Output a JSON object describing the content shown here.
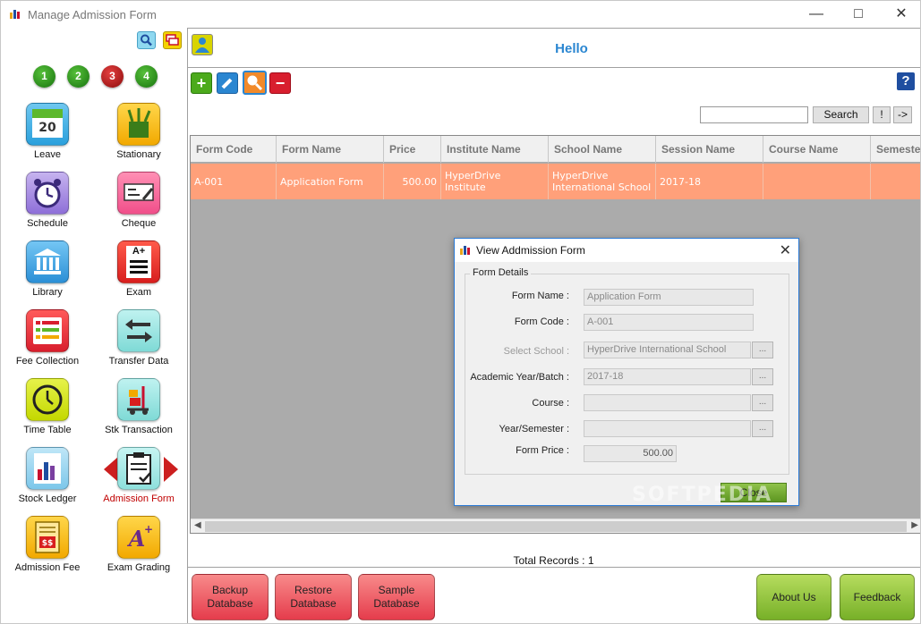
{
  "window": {
    "title": "Manage Admission Form"
  },
  "sidebar": {
    "steps": [
      "1",
      "2",
      "3",
      "4"
    ],
    "modules": [
      {
        "label": "Leave"
      },
      {
        "label": "Stationary"
      },
      {
        "label": "Schedule"
      },
      {
        "label": "Cheque"
      },
      {
        "label": "Library"
      },
      {
        "label": "Exam"
      },
      {
        "label": "Fee Collection"
      },
      {
        "label": "Transfer Data"
      },
      {
        "label": "Time Table"
      },
      {
        "label": "Stk Transaction"
      },
      {
        "label": "Stock Ledger"
      },
      {
        "label": "Admission Form"
      },
      {
        "label": "Admission Fee"
      },
      {
        "label": "Exam Grading"
      }
    ],
    "leave_day": "20",
    "exam_text": "A+"
  },
  "header": {
    "greeting": "Hello"
  },
  "toolbar": {
    "add": "+",
    "delete": "−",
    "help": "?"
  },
  "search": {
    "value": "",
    "button": "Search",
    "bang": "!",
    "arrow": "->"
  },
  "grid": {
    "columns": [
      {
        "label": "Form Code"
      },
      {
        "label": "Form Name"
      },
      {
        "label": "Price"
      },
      {
        "label": "Institute Name"
      },
      {
        "label": "School Name"
      },
      {
        "label": "Session Name"
      },
      {
        "label": "Course Name"
      },
      {
        "label": "Semester Name"
      }
    ],
    "rows": [
      {
        "form_code": "A-001",
        "form_name": "Application Form",
        "price": "500.00",
        "institute_name": "HyperDrive Institute",
        "school_name": "HyperDrive International School",
        "session_name": "2017-18",
        "course_name": "",
        "semester_name": ""
      }
    ],
    "selected_row_color": "#ffa07a"
  },
  "footer": {
    "total_records": "Total Records : 1",
    "backup": "Backup Database",
    "restore": "Restore Database",
    "sample": "Sample Database",
    "about": "About Us",
    "feedback": "Feedback"
  },
  "dialog": {
    "title": "View Addmission Form",
    "group": "Form Details",
    "form_name_label": "Form Name :",
    "form_name": "Application Form",
    "form_code_label": "Form Code :",
    "form_code": "A-001",
    "school_label": "Select School :",
    "school": "HyperDrive International School",
    "year_label": "Academic Year/Batch :",
    "year": "2017-18",
    "course_label": "Course :",
    "course": "",
    "semester_label": "Year/Semester :",
    "semester": "",
    "price_label": "Form Price :",
    "price": "500.00",
    "dots": "...",
    "close": "Close"
  },
  "watermark": "SOFTPEDIA",
  "colors": {
    "accent": "#2a86d1",
    "red_button": "#e53c4c",
    "green_button": "#77b028"
  }
}
